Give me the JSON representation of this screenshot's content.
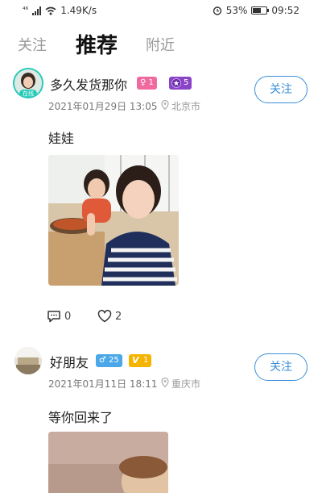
{
  "status_bar": {
    "network": "⁴⁶",
    "speed": "1.49K/s",
    "battery": "53%",
    "battery_level": 0.53,
    "time": "09:52"
  },
  "tabs": [
    {
      "label": "关注",
      "active": false
    },
    {
      "label": "推荐",
      "active": true
    },
    {
      "label": "附近",
      "active": false
    }
  ],
  "posts": [
    {
      "username": "多久发货那你",
      "gender_badge": "♀ 1",
      "level_badge": "5",
      "online_label": "在线",
      "time": "2021年01月29日 13:05",
      "location": "北京市",
      "follow_label": "关注",
      "text": "娃娃",
      "comments": "0",
      "likes": "2"
    },
    {
      "username": "好朋友",
      "gender_badge": "♂ 25",
      "level_badge": "1",
      "time": "2021年01月11日 18:11",
      "location": "重庆市",
      "follow_label": "关注",
      "text": "等你回来了"
    }
  ],
  "colors": {
    "accent": "#3a8fd9",
    "female": "#f06aa0",
    "male": "#4aa8e8",
    "level_purple": "#8b44c7",
    "vip_gold": "#f5b400",
    "online": "#23c9b8"
  }
}
